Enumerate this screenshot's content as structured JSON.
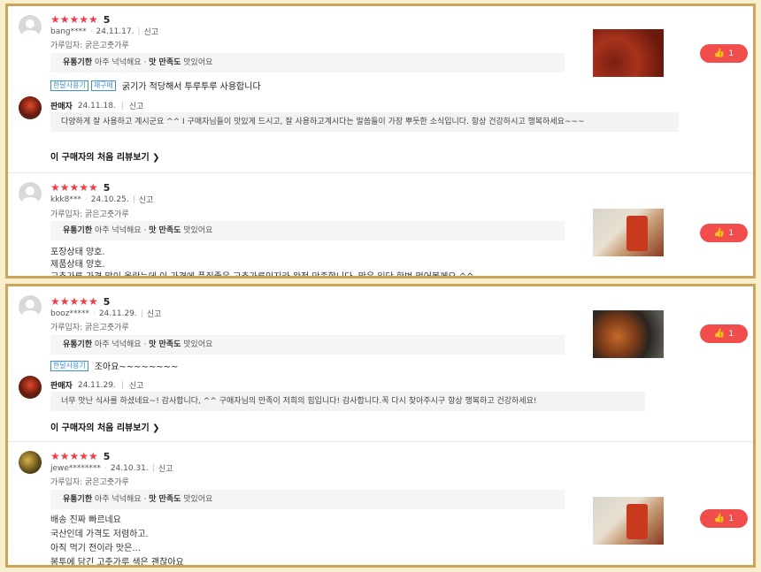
{
  "colors": {
    "accent": "#f24d4d",
    "stars": "#f23a4a",
    "frame": "#c9a65c",
    "chip": "#3f8fd8"
  },
  "common": {
    "stars": "★★★★★",
    "report": "신고",
    "tag_label_1": "유통기한",
    "tag_value_1": "아주 넉넉해요",
    "tag_label_2": "맛 만족도",
    "tag_value_2": "맛있어요",
    "first_review_link": "이 구매자의 처음 리뷰보기",
    "like_icon": "thumbs-up-icon",
    "seller_name": "판매자"
  },
  "reviews": [
    {
      "score": "5",
      "user": "bang****",
      "date": "24.11.17.",
      "option": "가루입자: 굵은고춧가루",
      "chips": [
        "한달사용기",
        "재구매"
      ],
      "chip_text": "굵기가 적당해서 투루투루 사용합니다",
      "likes": "1",
      "seller_date": "24.11.18.",
      "seller_reply": "다양하게 잘 사용하고 계시군요 ^^ I 구매자님들이 맛있게 드시고, 잘 사용하고계시다는 말씀들이 가장 뿌듯한 소식입니다. 항상 건강하시고 행복하세요~~~"
    },
    {
      "score": "5",
      "user": "kkk8***",
      "date": "24.10.25.",
      "option": "가루입자: 굵은고춧가루",
      "lines": [
        "포장상태 양호.",
        "제품상태 양호.",
        "고추가루 가격 많이 올랐는데 이 가격에 품질좋은 고추가루인지라 완전 만족합니다. 맛은 일단 한번 먹어볼께요.^^"
      ],
      "likes": "1"
    },
    {
      "score": "5",
      "user": "booz*****",
      "date": "24.11.29.",
      "option": "가루입자: 굵은고춧가루",
      "chips": [
        "한달사용기"
      ],
      "chip_text": "조아요~~~~~~~~",
      "likes": "1",
      "seller_date": "24.11.29.",
      "seller_reply": "너무 맛난 식사를 하셨네요~! 감사합니다, ^^  구매자님의 만족이 저희의 힘입니다! 감사합니다.꼭 다시 찾아주시구 항상 행복하고 건강하세요!"
    },
    {
      "score": "5",
      "user": "jewe********",
      "date": "24.10.31.",
      "option": "가루입자: 굵은고춧가루",
      "lines": [
        "배송 진짜 빠르네요",
        "국산인데 가격도 저렴하고.",
        "아직 먹기 전이라 맛은...",
        "봉투에 담긴 고춧가루 색은 괜찮아요"
      ],
      "likes": "1"
    }
  ]
}
